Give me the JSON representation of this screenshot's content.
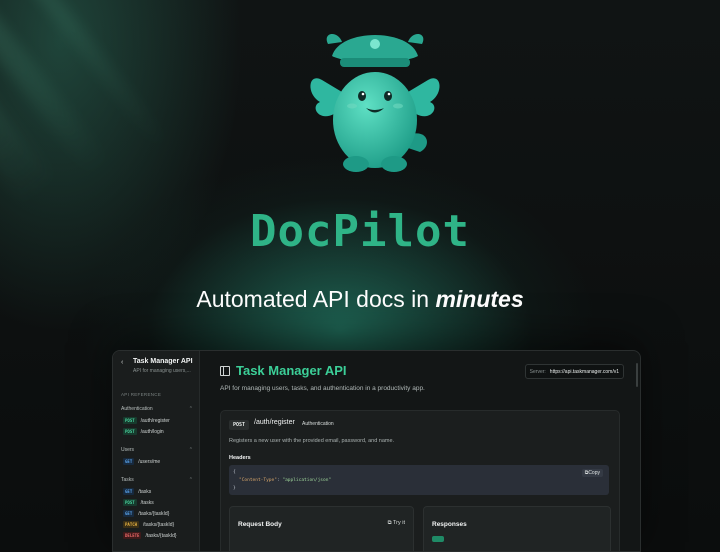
{
  "hero": {
    "brand": "DocPilot",
    "tagline_prefix": "Automated API docs in ",
    "tagline_emphasis": "minutes"
  },
  "sidebar": {
    "back": "‹",
    "title": "Task Manager API",
    "subtitle": "API for managing users,...",
    "section_label": "API REFERENCE",
    "groups": [
      {
        "label": "Authentication",
        "items": [
          {
            "method": "POST",
            "path": "/auth/register"
          },
          {
            "method": "POST",
            "path": "/auth/login"
          }
        ]
      },
      {
        "label": "Users",
        "items": [
          {
            "method": "GET",
            "path": "/users/me"
          }
        ]
      },
      {
        "label": "Tasks",
        "items": [
          {
            "method": "GET",
            "path": "/tasks"
          },
          {
            "method": "POST",
            "path": "/tasks"
          },
          {
            "method": "GET",
            "path": "/tasks/{taskId}"
          },
          {
            "method": "PATCH",
            "path": "/tasks/{taskId}"
          },
          {
            "method": "DELETE",
            "path": "/tasks/{taskId}"
          }
        ]
      }
    ]
  },
  "main": {
    "title": "Task Manager API",
    "server_label": "Server:",
    "server_value": "https://api.taskmanager.com/v1",
    "description": "API for managing users, tasks, and authentication in a productivity app.",
    "endpoint": {
      "method": "POST",
      "path": "/auth/register",
      "tag": "Authentication",
      "description": "Registers a new user with the provided email, password, and name.",
      "headers_label": "Headers",
      "code_open": "{",
      "code_key": "\"Content-Type\"",
      "code_colon": ": ",
      "code_value": "\"application/json\"",
      "code_close": "}",
      "copy_label": "Copy",
      "request_body_label": "Request Body",
      "try_it_label": "Try it",
      "responses_label": "Responses"
    }
  }
}
